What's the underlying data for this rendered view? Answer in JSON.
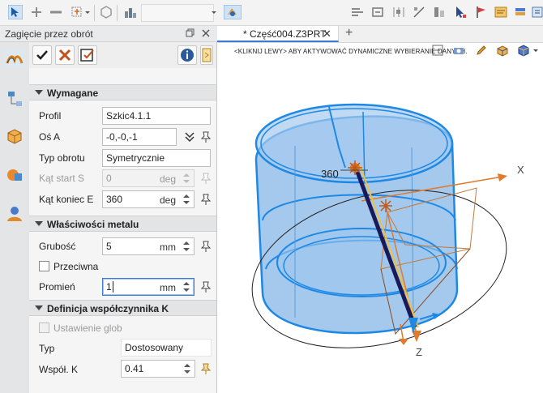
{
  "panel": {
    "title": "Zagięcie przez obrót"
  },
  "sections": {
    "required": "Wymagane",
    "metal": "Właściwości metalu",
    "kfactor": "Definicja współczynnika K"
  },
  "required": {
    "profile_label": "Profil",
    "profile_value": "Szkic4.1.1",
    "axis_label": "Oś A",
    "axis_value": "-0,-0,-1",
    "rot_type_label": "Typ obrotu",
    "rot_type_value": "Symetrycznie",
    "start_label": "Kąt start S",
    "start_value": "0",
    "start_unit": "deg",
    "end_label": "Kąt koniec E",
    "end_value": "360",
    "end_unit": "deg"
  },
  "metal": {
    "thickness_label": "Grubość",
    "thickness_value": "5",
    "thickness_unit": "mm",
    "reverse_label": "Przeciwna",
    "radius_label": "Promień",
    "radius_value": "1",
    "radius_unit": "mm"
  },
  "kfactor": {
    "global_label": "Ustawienie glob",
    "type_label": "Typ",
    "type_value": "Dostosowany",
    "k_label": "Współ. K",
    "k_value": "0.41"
  },
  "document": {
    "tab_label": "* Część004.Z3PRT",
    "close_glyph": "✕",
    "add_glyph": "+"
  },
  "viewport": {
    "hint": "<KLIKNIJ LEWY> ABY AKTYWOWAĆ DYNAMICZNE WYBIERANIE DANYCH.",
    "dim_value": "360",
    "axis_x": "X",
    "axis_z": "Z"
  },
  "colors": {
    "accent": "#3a7bd5",
    "model_fill": "#8fbbe8",
    "model_edge": "#1e88e5",
    "axis_orange": "#e07a2c"
  }
}
